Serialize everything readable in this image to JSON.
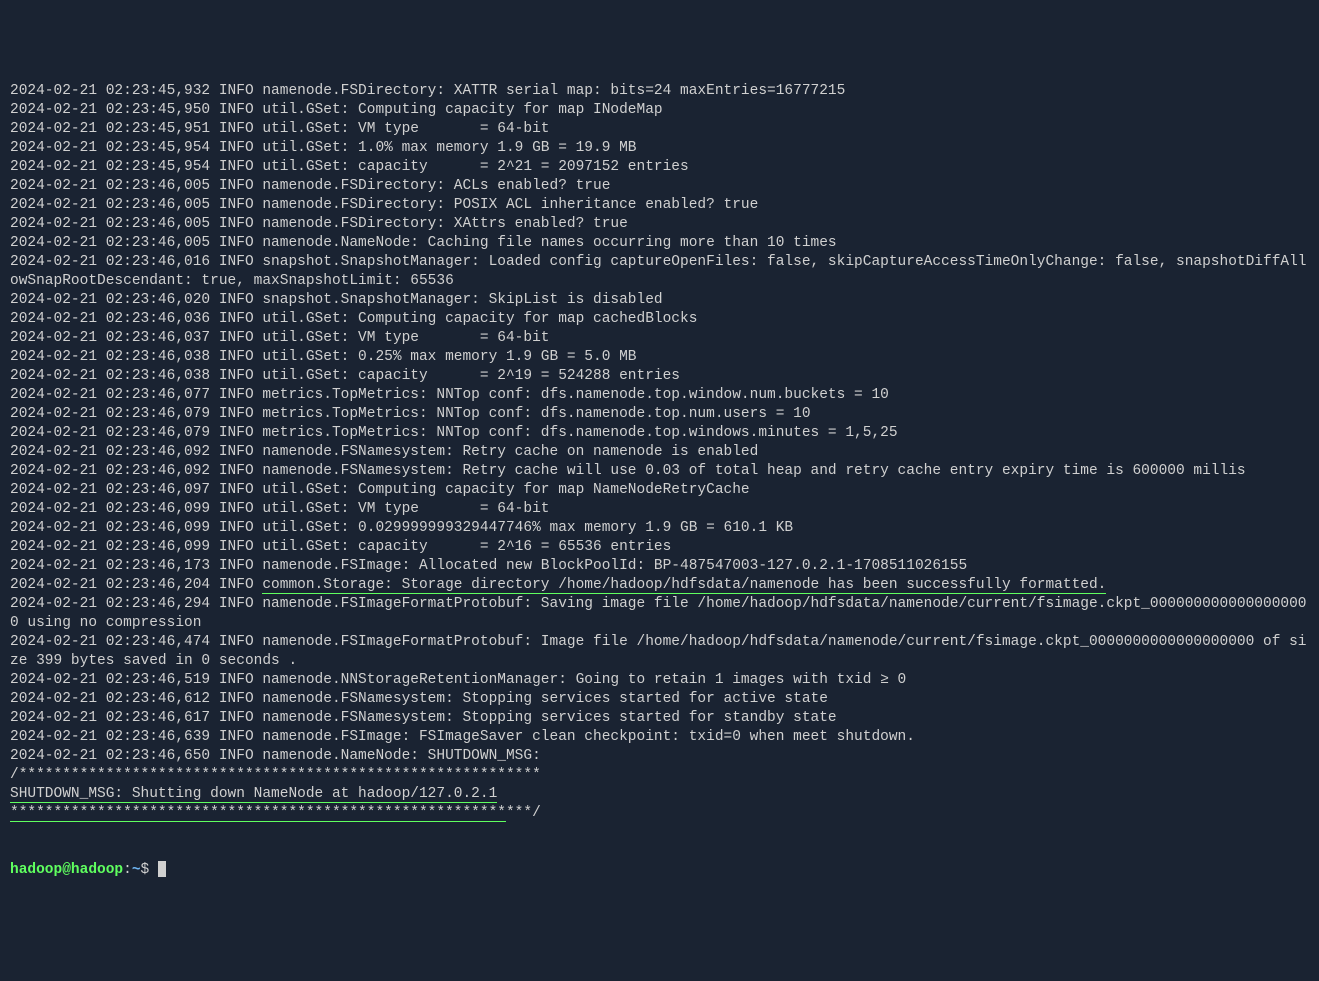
{
  "lines": [
    {
      "text": "2024-02-21 02:23:45,932 INFO namenode.FSDirectory: XATTR serial map: bits=24 maxEntries=16777215"
    },
    {
      "text": "2024-02-21 02:23:45,950 INFO util.GSet: Computing capacity for map INodeMap"
    },
    {
      "text": "2024-02-21 02:23:45,951 INFO util.GSet: VM type       = 64-bit"
    },
    {
      "text": "2024-02-21 02:23:45,954 INFO util.GSet: 1.0% max memory 1.9 GB = 19.9 MB"
    },
    {
      "text": "2024-02-21 02:23:45,954 INFO util.GSet: capacity      = 2^21 = 2097152 entries"
    },
    {
      "text": "2024-02-21 02:23:46,005 INFO namenode.FSDirectory: ACLs enabled? true"
    },
    {
      "text": "2024-02-21 02:23:46,005 INFO namenode.FSDirectory: POSIX ACL inheritance enabled? true"
    },
    {
      "text": "2024-02-21 02:23:46,005 INFO namenode.FSDirectory: XAttrs enabled? true"
    },
    {
      "text": "2024-02-21 02:23:46,005 INFO namenode.NameNode: Caching file names occurring more than 10 times"
    },
    {
      "text": "2024-02-21 02:23:46,016 INFO snapshot.SnapshotManager: Loaded config captureOpenFiles: false, skipCaptureAccessTimeOnlyChange: false, snapshotDiffAllowSnapRootDescendant: true, maxSnapshotLimit: 65536"
    },
    {
      "text": "2024-02-21 02:23:46,020 INFO snapshot.SnapshotManager: SkipList is disabled"
    },
    {
      "text": "2024-02-21 02:23:46,036 INFO util.GSet: Computing capacity for map cachedBlocks"
    },
    {
      "text": "2024-02-21 02:23:46,037 INFO util.GSet: VM type       = 64-bit"
    },
    {
      "text": "2024-02-21 02:23:46,038 INFO util.GSet: 0.25% max memory 1.9 GB = 5.0 MB"
    },
    {
      "text": "2024-02-21 02:23:46,038 INFO util.GSet: capacity      = 2^19 = 524288 entries"
    },
    {
      "text": "2024-02-21 02:23:46,077 INFO metrics.TopMetrics: NNTop conf: dfs.namenode.top.window.num.buckets = 10"
    },
    {
      "text": "2024-02-21 02:23:46,079 INFO metrics.TopMetrics: NNTop conf: dfs.namenode.top.num.users = 10"
    },
    {
      "text": "2024-02-21 02:23:46,079 INFO metrics.TopMetrics: NNTop conf: dfs.namenode.top.windows.minutes = 1,5,25"
    },
    {
      "text": "2024-02-21 02:23:46,092 INFO namenode.FSNamesystem: Retry cache on namenode is enabled"
    },
    {
      "text": "2024-02-21 02:23:46,092 INFO namenode.FSNamesystem: Retry cache will use 0.03 of total heap and retry cache entry expiry time is 600000 millis"
    },
    {
      "text": "2024-02-21 02:23:46,097 INFO util.GSet: Computing capacity for map NameNodeRetryCache"
    },
    {
      "text": "2024-02-21 02:23:46,099 INFO util.GSet: VM type       = 64-bit"
    },
    {
      "text": "2024-02-21 02:23:46,099 INFO util.GSet: 0.029999999329447746% max memory 1.9 GB = 610.1 KB"
    },
    {
      "text": "2024-02-21 02:23:46,099 INFO util.GSet: capacity      = 2^16 = 65536 entries"
    },
    {
      "text": "2024-02-21 02:23:46,173 INFO namenode.FSImage: Allocated new BlockPoolId: BP-487547003-127.0.2.1-1708511026155"
    },
    {
      "prefix": "2024-02-21 02:23:46,204 INFO ",
      "highlighted": "common.Storage: Storage directory /home/hadoop/hdfsdata/namenode has been successfully formatted."
    },
    {
      "text": "2024-02-21 02:23:46,294 INFO namenode.FSImageFormatProtobuf: Saving image file /home/hadoop/hdfsdata/namenode/current/fsimage.ckpt_0000000000000000000 using no compression",
      "faintUnderline": true
    },
    {
      "text": "2024-02-21 02:23:46,474 INFO namenode.FSImageFormatProtobuf: Image file /home/hadoop/hdfsdata/namenode/current/fsimage.ckpt_0000000000000000000 of size 399 bytes saved in 0 seconds ."
    },
    {
      "text": "2024-02-21 02:23:46,519 INFO namenode.NNStorageRetentionManager: Going to retain 1 images with txid ≥ 0"
    },
    {
      "text": "2024-02-21 02:23:46,612 INFO namenode.FSNamesystem: Stopping services started for active state"
    },
    {
      "text": "2024-02-21 02:23:46,617 INFO namenode.FSNamesystem: Stopping services started for standby state"
    },
    {
      "text": "2024-02-21 02:23:46,639 INFO namenode.FSImage: FSImageSaver clean checkpoint: txid=0 when meet shutdown."
    },
    {
      "text": "2024-02-21 02:23:46,650 INFO namenode.NameNode: SHUTDOWN_MSG:"
    },
    {
      "text": "/************************************************************"
    },
    {
      "highlighted": "SHUTDOWN_MSG: Shutting down NameNode at hadoop/127.0.2.1"
    },
    {
      "prefix_h": "*********************************************************",
      "text": "***/"
    }
  ],
  "prompt": {
    "user": "hadoop@hadoop",
    "path": "~",
    "symbol": "$"
  }
}
